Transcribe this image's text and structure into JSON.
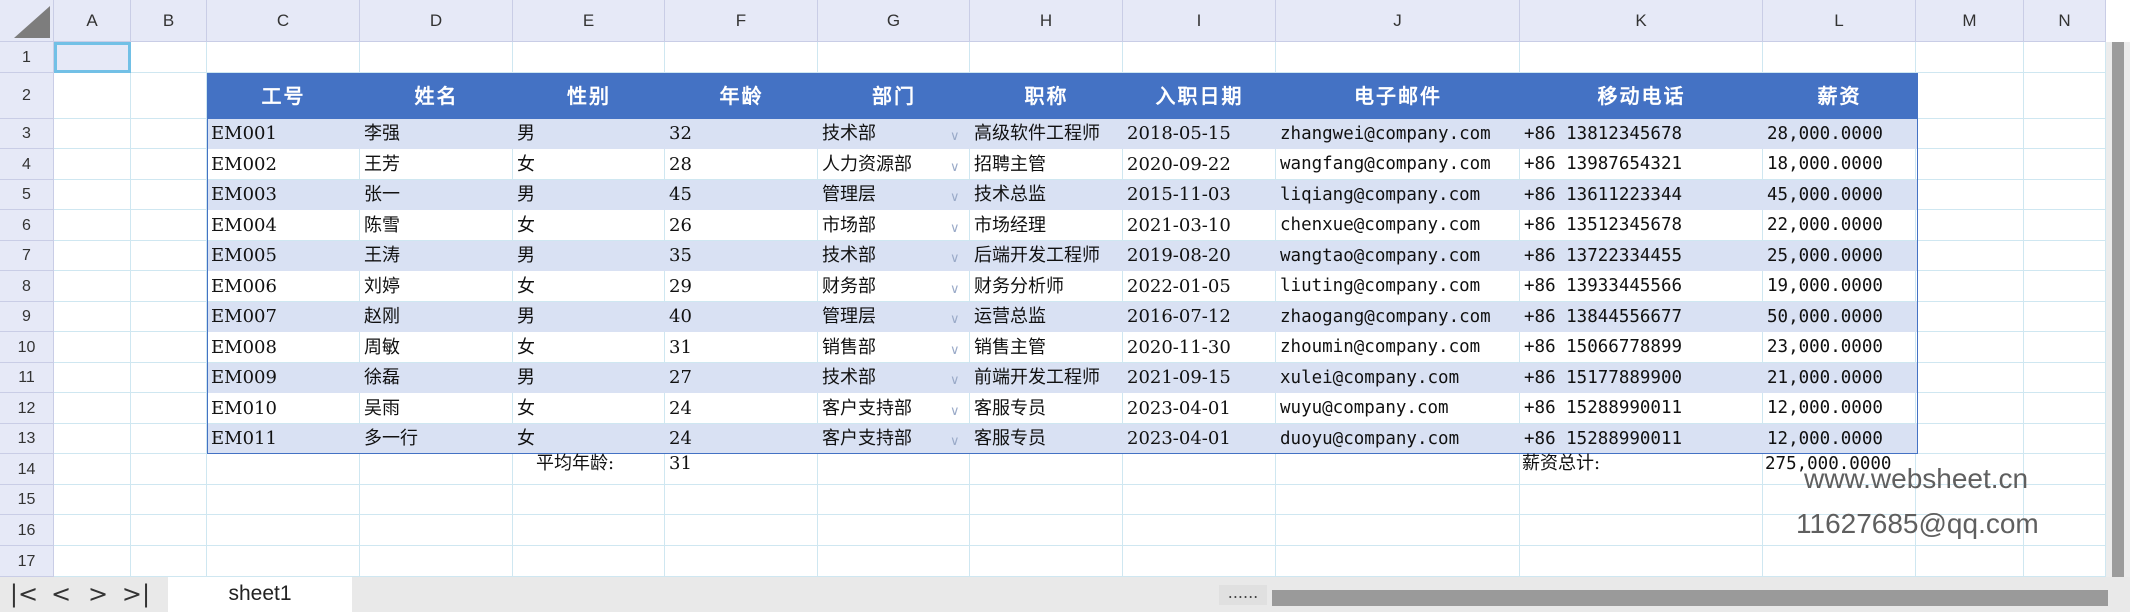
{
  "columns": [
    "A",
    "B",
    "C",
    "D",
    "E",
    "F",
    "G",
    "H",
    "I",
    "J",
    "K",
    "L",
    "M",
    "N"
  ],
  "rows": [
    "1",
    "2",
    "3",
    "4",
    "5",
    "6",
    "7",
    "8",
    "9",
    "10",
    "11",
    "12",
    "13",
    "14",
    "15",
    "16",
    "17"
  ],
  "table": {
    "headers": [
      "工号",
      "姓名",
      "性别",
      "年龄",
      "部门",
      "职称",
      "入职日期",
      "电子邮件",
      "移动电话",
      "薪资"
    ],
    "rows": [
      [
        "EM001",
        "李强",
        "男",
        "32",
        "技术部",
        "高级软件工程师",
        "2018-05-15",
        "zhangwei@company.com",
        "+86 13812345678",
        "28,000.0000"
      ],
      [
        "EM002",
        "王芳",
        "女",
        "28",
        "人力资源部",
        "招聘主管",
        "2020-09-22",
        "wangfang@company.com",
        "+86 13987654321",
        "18,000.0000"
      ],
      [
        "EM003",
        "张一",
        "男",
        "45",
        "管理层",
        "技术总监",
        "2015-11-03",
        "liqiang@company.com",
        "+86 13611223344",
        "45,000.0000"
      ],
      [
        "EM004",
        "陈雪",
        "女",
        "26",
        "市场部",
        "市场经理",
        "2021-03-10",
        "chenxue@company.com",
        "+86 13512345678",
        "22,000.0000"
      ],
      [
        "EM005",
        "王涛",
        "男",
        "35",
        "技术部",
        "后端开发工程师",
        "2019-08-20",
        "wangtao@company.com",
        "+86 13722334455",
        "25,000.0000"
      ],
      [
        "EM006",
        "刘婷",
        "女",
        "29",
        "财务部",
        "财务分析师",
        "2022-01-05",
        "liuting@company.com",
        "+86 13933445566",
        "19,000.0000"
      ],
      [
        "EM007",
        "赵刚",
        "男",
        "40",
        "管理层",
        "运营总监",
        "2016-07-12",
        "zhaogang@company.com",
        "+86 13844556677",
        "50,000.0000"
      ],
      [
        "EM008",
        "周敏",
        "女",
        "31",
        "销售部",
        "销售主管",
        "2020-11-30",
        "zhoumin@company.com",
        "+86 15066778899",
        "23,000.0000"
      ],
      [
        "EM009",
        "徐磊",
        "男",
        "27",
        "技术部",
        "前端开发工程师",
        "2021-09-15",
        "xulei@company.com",
        "+86 15177889900",
        "21,000.0000"
      ],
      [
        "EM010",
        "吴雨",
        "女",
        "24",
        "客户支持部",
        "客服专员",
        "2023-04-01",
        "wuyu@company.com",
        "+86 15288990011",
        "12,000.0000"
      ],
      [
        "EM011",
        "多一行",
        "女",
        "24",
        "客户支持部",
        "客服专员",
        "2023-04-01",
        "duoyu@company.com",
        "+86 15288990011",
        "12,000.0000"
      ]
    ]
  },
  "summary": {
    "avg_age_label": "平均年龄:",
    "avg_age_value": "31",
    "salary_total_label": "薪资总计:",
    "salary_total_value": "275,000.0000"
  },
  "watermark": {
    "line1": "www.websheet.cn",
    "line2": "11627685@qq.com"
  },
  "sheet_tab": "sheet1",
  "nav_icons": [
    "first-sheet-icon",
    "prev-sheet-icon",
    "next-sheet-icon",
    "last-sheet-icon"
  ],
  "nav_glyphs": [
    "|<",
    "<",
    ">",
    ">|"
  ],
  "splitter_glyph": "......",
  "colors": {
    "header_fill": "#4472c4",
    "band_fill": "#d9e1f3",
    "header_bg": "#e6e9f7",
    "gridline": "#cfe7f1"
  }
}
